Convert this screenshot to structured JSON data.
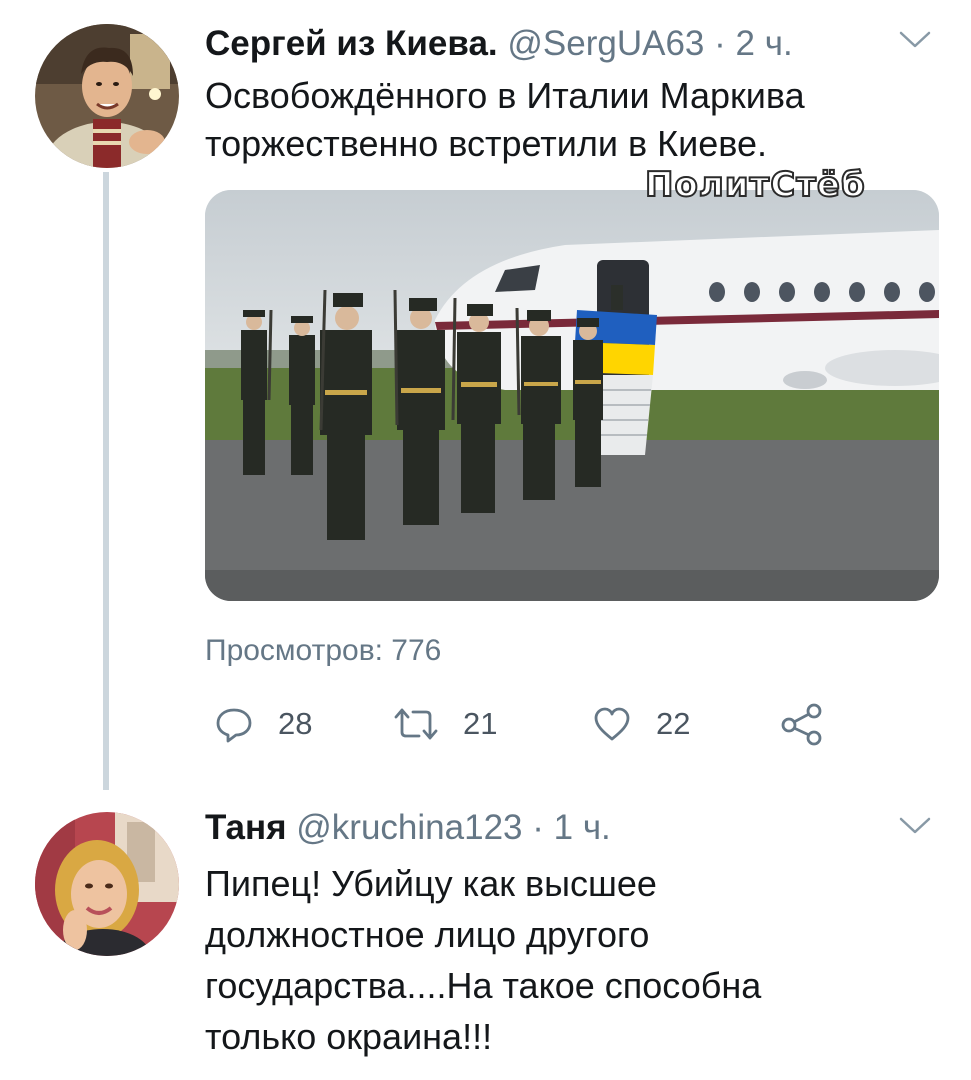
{
  "tweet1": {
    "author_name": "Сергей из Киева.",
    "handle": "@SergUA63",
    "separator": "·",
    "time": "2 ч.",
    "text_lines": [
      "Освобождённого в Италии Маркива",
      "торжественно встретили в Киеве."
    ],
    "watermark": "ПолитСтёб",
    "views": "Просмотров: 776",
    "actions": {
      "replies": "28",
      "retweets": "21",
      "likes": "22"
    }
  },
  "tweet2": {
    "author_name": "Таня",
    "handle": "@kruchina123",
    "separator": "·",
    "time": "1 ч.",
    "text_lines": [
      "Пипец! Убийцу как высшее",
      "должностное лицо другого",
      "государства....На такое способна",
      "только окраина!!!"
    ]
  },
  "colors": {
    "text": "#14171a",
    "meta": "#657786",
    "thread_line": "#ccd6dd",
    "flag_blue": "#1f5fbf",
    "flag_yellow": "#ffd500"
  },
  "icons": [
    "reply-icon",
    "retweet-icon",
    "like-icon",
    "share-icon",
    "chevron-down-icon"
  ]
}
